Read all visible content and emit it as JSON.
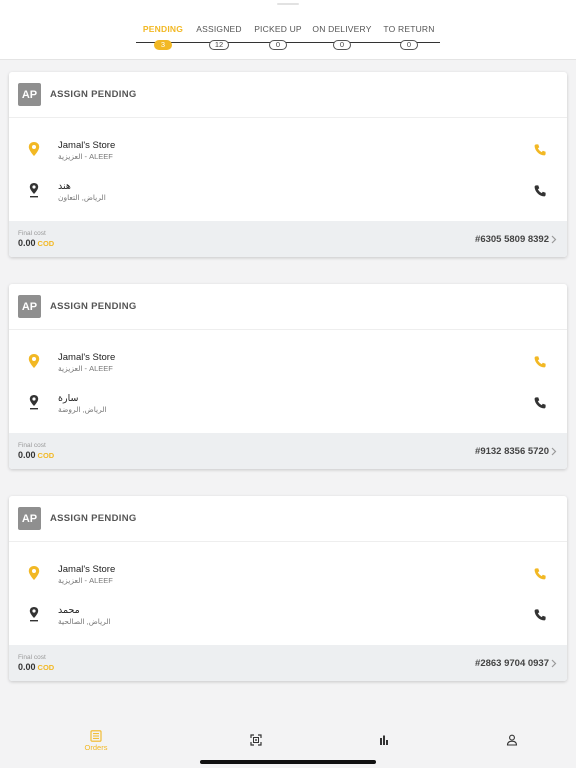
{
  "colors": {
    "accent": "#f2b824",
    "avatar": "#8f8f8f",
    "footer": "#edeff1"
  },
  "tabs": [
    {
      "label": "PENDING",
      "count": "3",
      "active": true
    },
    {
      "label": "ASSIGNED",
      "count": "12",
      "active": false
    },
    {
      "label": "PICKED UP",
      "count": "0",
      "active": false
    },
    {
      "label": "ON DELIVERY",
      "count": "0",
      "active": false
    },
    {
      "label": "TO RETURN",
      "count": "0",
      "active": false
    }
  ],
  "orders": [
    {
      "avatar": "AP",
      "status": "ASSIGN PENDING",
      "pickup": {
        "name": "Jamal's Store",
        "address": "العزيزية - ALEEF",
        "icon": "pickup-pin-icon"
      },
      "dropoff": {
        "name": "هند",
        "address": "الرياض, التعاون",
        "icon": "dropoff-pin-icon"
      },
      "cost_label": "Final cost",
      "cost_value": "0.00",
      "cost_method": "COD",
      "order_number": "#6305 5809 8392"
    },
    {
      "avatar": "AP",
      "status": "ASSIGN PENDING",
      "pickup": {
        "name": "Jamal's Store",
        "address": "العزيزية - ALEEF",
        "icon": "pickup-pin-icon"
      },
      "dropoff": {
        "name": "سارة",
        "address": "الرياض, الروضة",
        "icon": "dropoff-pin-icon"
      },
      "cost_label": "Final cost",
      "cost_value": "0.00",
      "cost_method": "COD",
      "order_number": "#9132 8356 5720"
    },
    {
      "avatar": "AP",
      "status": "ASSIGN PENDING",
      "pickup": {
        "name": "Jamal's Store",
        "address": "العزيزية - ALEEF",
        "icon": "pickup-pin-icon"
      },
      "dropoff": {
        "name": "محمد",
        "address": "الرياض, الصالحية",
        "icon": "dropoff-pin-icon"
      },
      "cost_label": "Final cost",
      "cost_value": "0.00",
      "cost_method": "COD",
      "order_number": "#2863 9704 0937"
    }
  ],
  "bottom_nav": {
    "orders_label": "Orders",
    "icons": [
      "orders-icon",
      "scan-icon",
      "stats-icon",
      "profile-icon"
    ]
  }
}
